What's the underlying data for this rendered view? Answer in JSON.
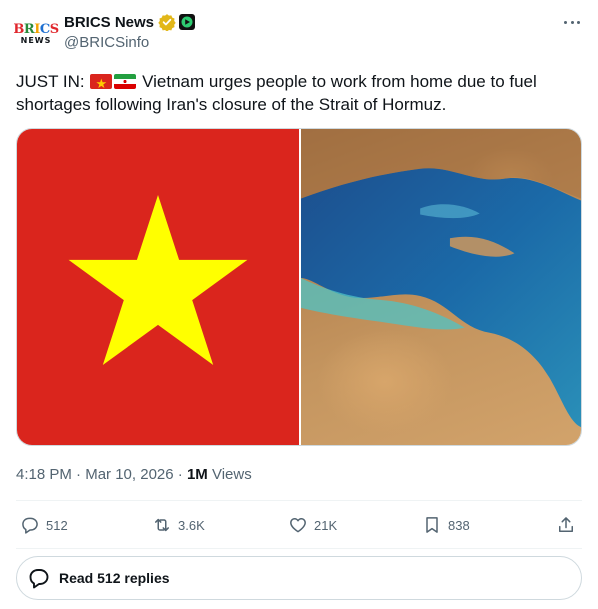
{
  "account": {
    "display_name": "BRICS News",
    "handle": "@BRICSinfo",
    "avatar_line1": [
      "B",
      "R",
      "I",
      "C",
      "S"
    ],
    "avatar_line2": "NEWS"
  },
  "tweet": {
    "prefix": "JUST IN: ",
    "flags": [
      "vietnam-flag",
      "iran-flag"
    ],
    "body": " Vietnam urges people to work from home due to fuel shortages following Iran's closure of the Strait of Hormuz."
  },
  "meta": {
    "time": "4:18 PM",
    "date": "Mar 10, 2026",
    "views_count": "1M",
    "views_label": "Views"
  },
  "actions": {
    "replies": "512",
    "reposts": "3.6K",
    "likes": "21K",
    "bookmarks": "838"
  },
  "read_replies_label": "Read 512 replies",
  "colors": {
    "text": "#0f1419",
    "secondary": "#536471",
    "border": "#cfd9de",
    "vietnam_red": "#da251d",
    "vietnam_star": "#ffff00"
  }
}
